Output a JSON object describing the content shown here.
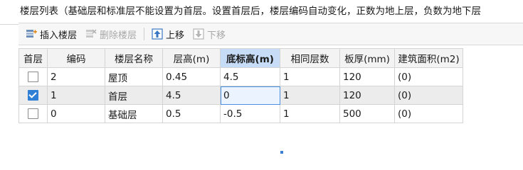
{
  "title": "楼层列表（基础层和标准层不能设置为首层。设置首层后，楼层编码自动变化，正数为地上层，负数为地下层",
  "toolbar": {
    "insert": "插入楼层",
    "delete": "删除楼层",
    "up": "上移",
    "down": "下移"
  },
  "columns": [
    "首层",
    "编码",
    "楼层名称",
    "层高(m)",
    "底标高(m)",
    "相同层数",
    "板厚(mm)",
    "建筑面积(m2)"
  ],
  "rows": [
    {
      "is_first": false,
      "code": "2",
      "name": "屋顶",
      "height": "0.45",
      "bottom": "4.5",
      "same": "1",
      "thick": "120",
      "area": "(0)"
    },
    {
      "is_first": true,
      "code": "1",
      "name": "首层",
      "height": "4.5",
      "bottom": "0",
      "same": "1",
      "thick": "120",
      "area": "(0)"
    },
    {
      "is_first": false,
      "code": "0",
      "name": "基础层",
      "height": "0.5",
      "bottom": "-0.5",
      "same": "1",
      "thick": "500",
      "area": "(0)"
    }
  ],
  "colors": {
    "active_header": "#c7dcf7",
    "checkbox_checked": "#2f7fd6",
    "selected_row": "#ececec"
  }
}
